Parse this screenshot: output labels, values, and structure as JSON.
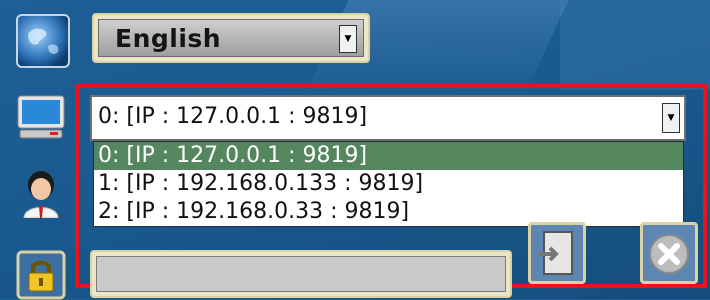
{
  "language_select": {
    "value": "English",
    "arrow_icon": "dropdown-arrow-icon"
  },
  "connection_select": {
    "value": "0: [IP : 127.0.0.1 : 9819]",
    "options": [
      "0: [IP : 127.0.0.1 : 9819]",
      "1: [IP : 192.168.0.133 : 9819]",
      "2: [IP : 192.168.0.33 : 9819]"
    ],
    "selected_index": 0
  },
  "icons": {
    "language": "globe-icon",
    "connection": "monitor-icon",
    "user": "user-avatar-icon",
    "password": "lock-icon",
    "login": "login-door-icon",
    "close": "close-icon"
  },
  "colors": {
    "background": "#1a5a8f",
    "highlight_frame": "#e8141b",
    "selected_option": "#55875f",
    "field_frame": "#ebe6c8"
  }
}
